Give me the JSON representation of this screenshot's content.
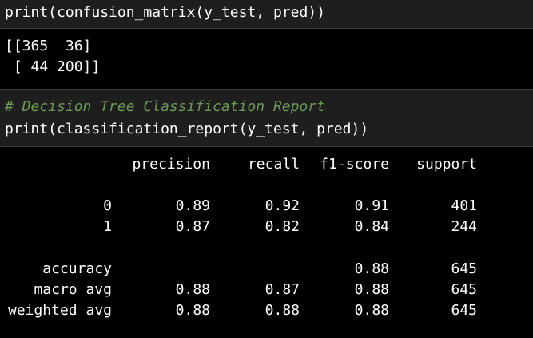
{
  "cell1": {
    "code": "print(confusion_matrix(y_test, pred))"
  },
  "output1": {
    "lines": [
      "[[365  36]",
      " [ 44 200]]"
    ]
  },
  "cell2": {
    "comment": "# Decision Tree Classification Report",
    "code": "print(classification_report(y_test, pred))"
  },
  "report": {
    "headers": [
      "precision",
      "recall",
      "f1-score",
      "support"
    ],
    "rows": [
      {
        "label": "0",
        "precision": "0.89",
        "recall": "0.92",
        "f1": "0.91",
        "support": "401"
      },
      {
        "label": "1",
        "precision": "0.87",
        "recall": "0.82",
        "f1": "0.84",
        "support": "244"
      },
      {
        "label": "accuracy",
        "precision": "",
        "recall": "",
        "f1": "0.88",
        "support": "645"
      },
      {
        "label": "macro avg",
        "precision": "0.88",
        "recall": "0.87",
        "f1": "0.88",
        "support": "645"
      },
      {
        "label": "weighted avg",
        "precision": "0.88",
        "recall": "0.88",
        "f1": "0.88",
        "support": "645"
      }
    ]
  }
}
